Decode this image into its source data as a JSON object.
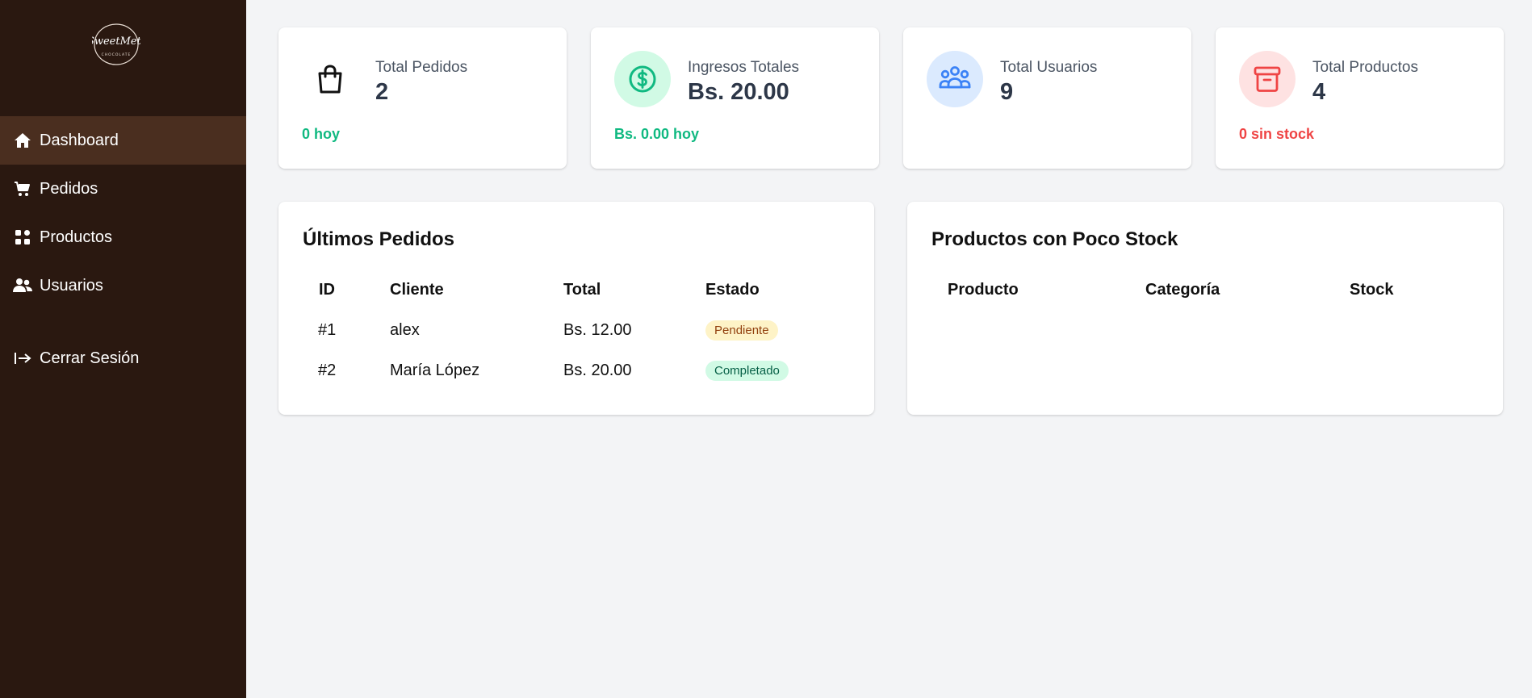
{
  "sidebar": {
    "logo_text": "SweetMett",
    "logo_subtext": "CHOCOLATE",
    "items": [
      {
        "label": "Dashboard",
        "icon": "home-icon",
        "active": true
      },
      {
        "label": "Pedidos",
        "icon": "cart-icon"
      },
      {
        "label": "Productos",
        "icon": "grid-icon"
      },
      {
        "label": "Usuarios",
        "icon": "users-icon"
      }
    ],
    "logout_label": "Cerrar Sesión"
  },
  "stats": [
    {
      "label": "Total Pedidos",
      "value": "2",
      "footer": "0 hoy",
      "icon": "shopping-bag-icon",
      "footer_color": "#10b981"
    },
    {
      "label": "Ingresos Totales",
      "value": "Bs. 20.00",
      "footer": "Bs. 0.00 hoy",
      "icon": "dollar-icon",
      "icon_bg": "#d1fae5",
      "icon_color": "#10b981",
      "footer_color": "#10b981"
    },
    {
      "label": "Total Usuarios",
      "value": "9",
      "footer": "",
      "icon": "users-group-icon",
      "icon_bg": "#dbeafe",
      "icon_color": "#3b82f6"
    },
    {
      "label": "Total Productos",
      "value": "4",
      "footer": "0 sin stock",
      "icon": "archive-icon",
      "icon_bg": "#fee2e2",
      "icon_color": "#ef4444",
      "footer_color": "#ef4444"
    }
  ],
  "orders": {
    "title": "Últimos Pedidos",
    "headers": [
      "ID",
      "Cliente",
      "Total",
      "Estado"
    ],
    "rows": [
      {
        "id": "#1",
        "client": "alex",
        "total": "Bs. 12.00",
        "status": "Pendiente"
      },
      {
        "id": "#2",
        "client": "María López",
        "total": "Bs. 20.00",
        "status": "Completado"
      }
    ]
  },
  "low_stock": {
    "title": "Productos con Poco Stock",
    "headers": [
      "Producto",
      "Categoría",
      "Stock"
    ]
  },
  "colors": {
    "sidebar_bg": "#2a1810",
    "sidebar_active": "#4a2e1f",
    "pending_bg": "#fef3c7",
    "pending_text": "#92400e",
    "completed_bg": "#d1fae5",
    "completed_text": "#065f46"
  }
}
